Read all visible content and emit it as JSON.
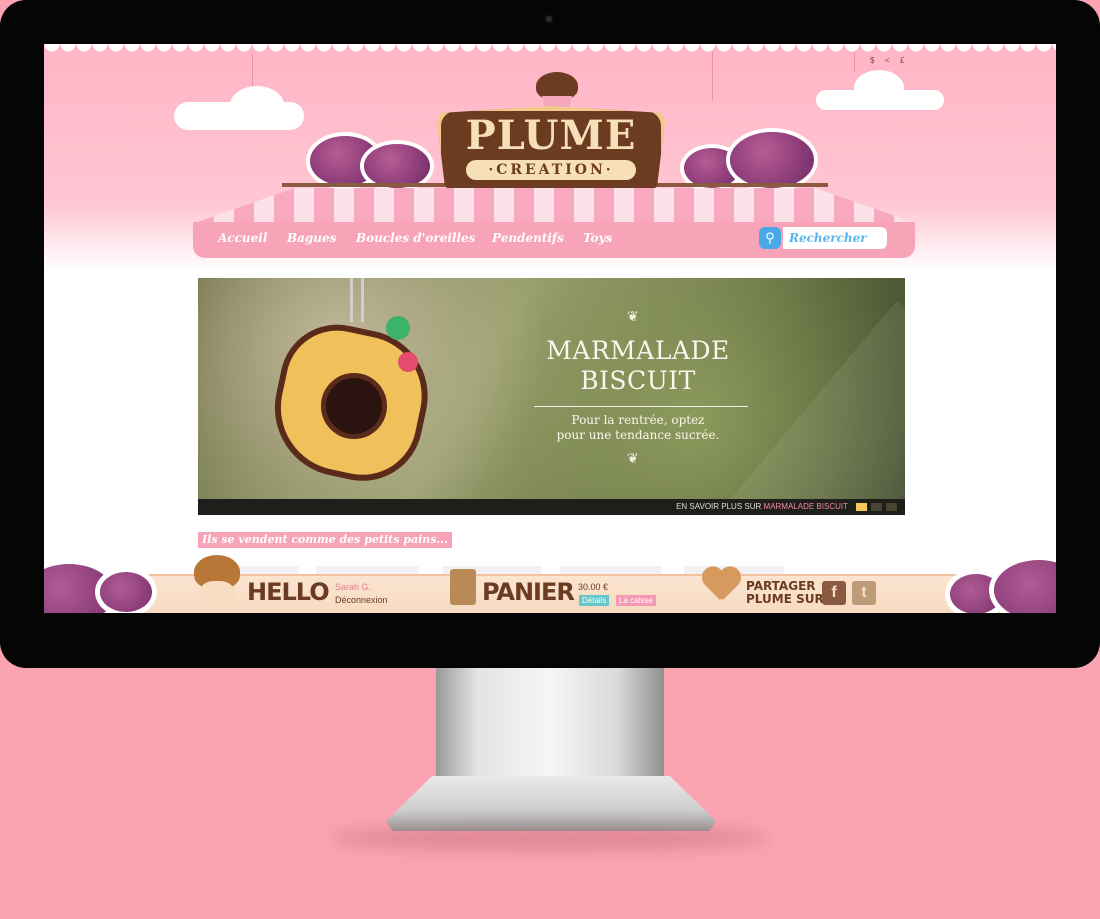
{
  "currency": [
    "$",
    "<",
    "£"
  ],
  "brand": {
    "line1": "PLUME",
    "line2": "·CREATION·"
  },
  "nav": {
    "items": [
      {
        "label": "Accueil"
      },
      {
        "label": "Bagues"
      },
      {
        "label": "Boucles d'oreilles"
      },
      {
        "label": "Pendentifs"
      },
      {
        "label": "Toys"
      }
    ],
    "search_placeholder": "Rechercher"
  },
  "banner": {
    "title_line1": "MARMALADE",
    "title_line2": "BISCUIT",
    "subtitle_line1": "Pour la rentrée, optez",
    "subtitle_line2": "pour une tendance sucrée.",
    "more_prefix": "EN SAVOIR PLUS SUR",
    "more_link": "MARMALADE BISCUIT",
    "slide_dots": [
      "#f6c85c",
      "#4a4530",
      "#4a4530"
    ]
  },
  "section_title": "Ils se vendent comme des petits pains...",
  "footer": {
    "hello": "HELLO",
    "user_name": "Sarah G.",
    "logout": "Déconnexion",
    "cart": "PANIER",
    "cart_total": "30.00 €",
    "details": "Détails",
    "checkout": "La caisse",
    "share_line1": "PARTAGER",
    "share_line2": "PLUME SUR",
    "facebook": "f",
    "twitter": "t"
  },
  "colors": {
    "pink": "#f7a4b9",
    "brown": "#6b3b22",
    "blue": "#4aa8e8",
    "details_chip": "#64c7c9",
    "checkout_chip": "#f49bb3"
  }
}
